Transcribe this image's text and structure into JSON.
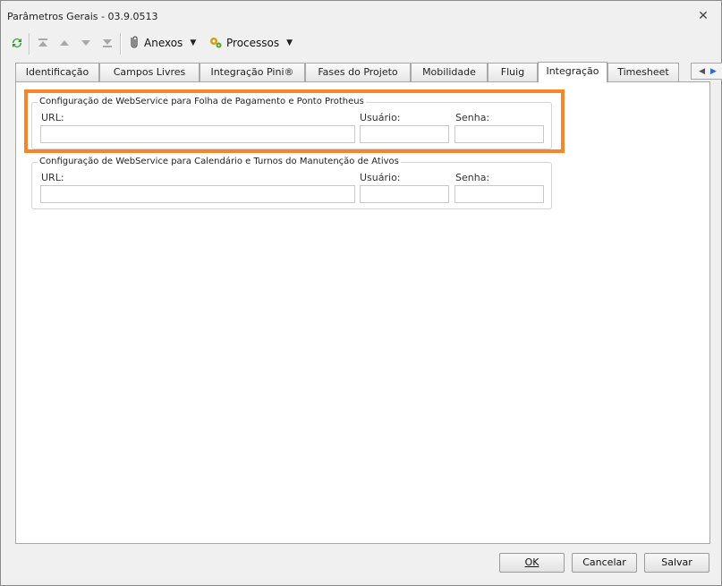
{
  "window": {
    "title": "Parâmetros Gerais - 03.9.0513"
  },
  "toolbar": {
    "anexos_label": "Anexos",
    "processos_label": "Processos"
  },
  "tabs": [
    {
      "label": "Identificação"
    },
    {
      "label": "Campos Livres"
    },
    {
      "label": "Integração Pini®"
    },
    {
      "label": "Fases do Projeto"
    },
    {
      "label": "Mobilidade"
    },
    {
      "label": "Fluig"
    },
    {
      "label": "Integração",
      "active": true
    },
    {
      "label": "Timesheet"
    }
  ],
  "groups": [
    {
      "title": "Configuração de WebService para Folha de Pagamento e Ponto Protheus",
      "url_label": "URL:",
      "url_value": "",
      "user_label": "Usuário:",
      "user_value": "",
      "pass_label": "Senha:",
      "pass_value": ""
    },
    {
      "title": "Configuração de WebService para Calendário e Turnos do Manutenção de Ativos",
      "url_label": "URL:",
      "url_value": "",
      "user_label": "Usuário:",
      "user_value": "",
      "pass_label": "Senha:",
      "pass_value": ""
    }
  ],
  "footer": {
    "ok_label": "OK",
    "cancel_label": "Cancelar",
    "save_label": "Salvar"
  },
  "colors": {
    "highlight": "#f7862b"
  }
}
